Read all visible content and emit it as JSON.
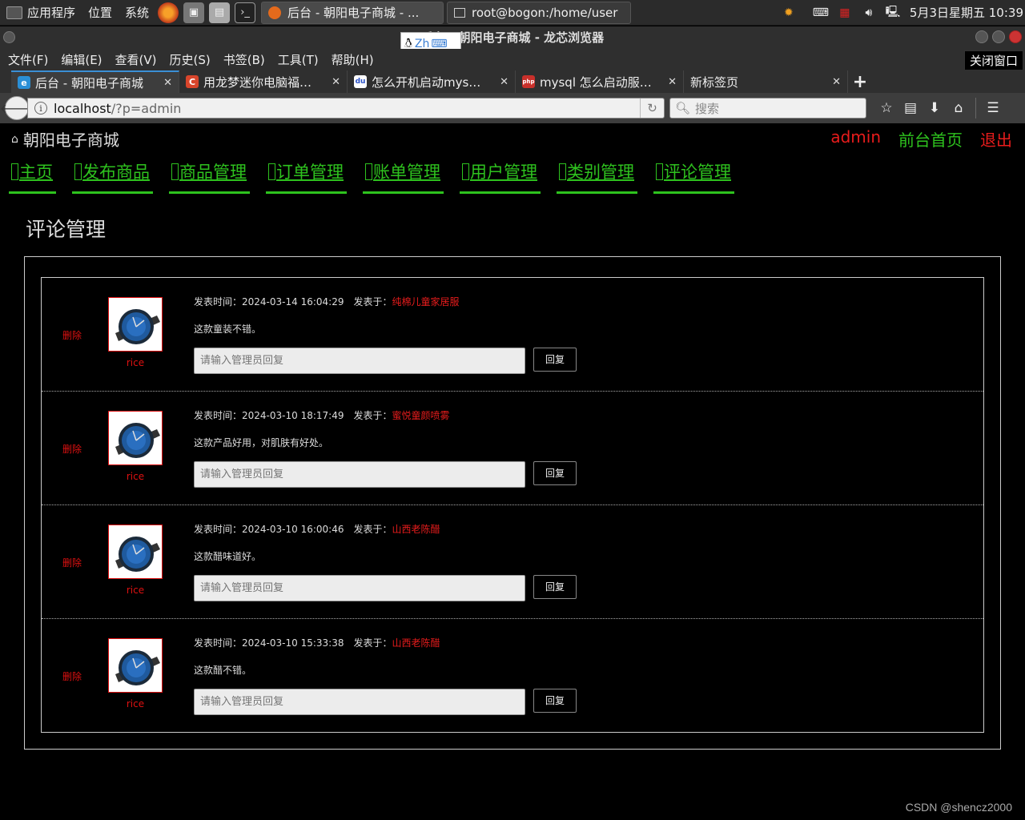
{
  "panel": {
    "apps": "应用程序",
    "places": "位置",
    "system": "系统",
    "tasks": [
      "后台 - 朝阳电子商城 - ...",
      "root@bogon:/home/user"
    ],
    "clock": "5月3日星期五 10:39"
  },
  "browser": {
    "title": "后台 - 朝阳电子商城 - 龙芯浏览器",
    "ime": "Zh",
    "close_window": "关闭窗口",
    "menu": [
      "文件(F)",
      "编辑(E)",
      "查看(V)",
      "历史(S)",
      "书签(B)",
      "工具(T)",
      "帮助(H)"
    ],
    "tabs": [
      {
        "label": "后台 - 朝阳电子商城",
        "icon_color": "#2a8fd6",
        "icon": "e"
      },
      {
        "label": "用龙梦迷你电脑福…",
        "icon_color": "#d9452b",
        "icon": "C"
      },
      {
        "label": "怎么开机启动mys…",
        "icon_color": "#2b52c9",
        "icon": "du"
      },
      {
        "label": "mysql 怎么启动服…",
        "icon_color": "#c9302b",
        "icon": "php"
      },
      {
        "label": "新标签页",
        "icon_color": "",
        "icon": ""
      }
    ],
    "url_host": "localhost",
    "url_path": "/?p=admin",
    "search_placeholder": "搜索"
  },
  "site": {
    "title": "朝阳电子商城",
    "user": "admin",
    "front": "前台首页",
    "logout": "退出",
    "nav": [
      "主页",
      "发布商品",
      "商品管理",
      "订单管理",
      "账单管理",
      "用户管理",
      "类别管理",
      "评论管理"
    ],
    "section_title": "评论管理"
  },
  "comments": [
    {
      "delete": "删除",
      "user": "rice",
      "time_label": "发表时间：",
      "time": "2024-03-14 16:04:29",
      "on_label": "发表于：",
      "product": "纯棉儿童家居服",
      "content": "这款童装不错。",
      "reply_placeholder": "请输入管理员回复",
      "reply_button": "回复"
    },
    {
      "delete": "删除",
      "user": "rice",
      "time_label": "发表时间：",
      "time": "2024-03-10 18:17:49",
      "on_label": "发表于：",
      "product": "蜜悦童颜喷雾",
      "content": "这款产品好用，对肌肤有好处。",
      "reply_placeholder": "请输入管理员回复",
      "reply_button": "回复"
    },
    {
      "delete": "删除",
      "user": "rice",
      "time_label": "发表时间：",
      "time": "2024-03-10 16:00:46",
      "on_label": "发表于：",
      "product": "山西老陈醋",
      "content": "这款醋味道好。",
      "reply_placeholder": "请输入管理员回复",
      "reply_button": "回复"
    },
    {
      "delete": "删除",
      "user": "rice",
      "time_label": "发表时间：",
      "time": "2024-03-10 15:33:38",
      "on_label": "发表于：",
      "product": "山西老陈醋",
      "content": "这款醋不错。",
      "reply_placeholder": "请输入管理员回复",
      "reply_button": "回复"
    }
  ],
  "watermark": "CSDN @shencz2000"
}
